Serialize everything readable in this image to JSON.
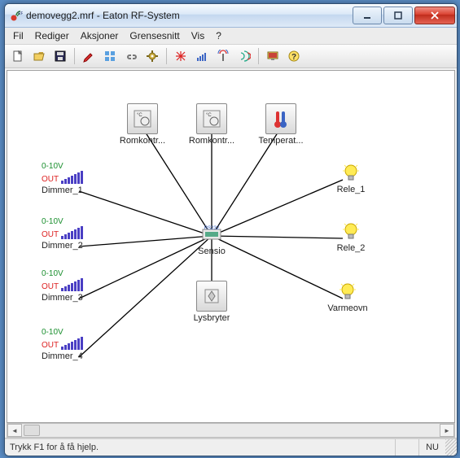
{
  "window": {
    "title": "demovegg2.mrf - Eaton RF-System"
  },
  "menus": {
    "file": "Fil",
    "edit": "Rediger",
    "actions": "Aksjoner",
    "interface": "Grensesnitt",
    "view": "Vis",
    "help": "?"
  },
  "statusbar": {
    "help_text": "Trykk F1 for å få hjelp.",
    "indicator": "NU"
  },
  "nodes": {
    "romkontr1": "Romkontr...",
    "romkontr2": "Romkontr...",
    "temperat": "Temperat...",
    "sensio": "Sensio",
    "lysbryter": "Lysbryter",
    "dimmer1": "Dimmer_1",
    "dimmer2": "Dimmer_2",
    "dimmer3": "Dimmer_3",
    "dimmer4": "Dimmer_4",
    "rele1": "Rele_1",
    "rele2": "Rele_2",
    "varmeovn": "Varmeovn",
    "d_top": "0-10V",
    "d_out": "OUT"
  },
  "toolbar_icons": [
    "new-file-icon",
    "open-file-icon",
    "save-icon",
    "pencil-icon",
    "grid-icon",
    "link-icon",
    "gear-icon",
    "burst-red-icon",
    "signal-bars-icon",
    "antenna-icon",
    "wave-icon",
    "monitor-icon",
    "question-icon"
  ]
}
